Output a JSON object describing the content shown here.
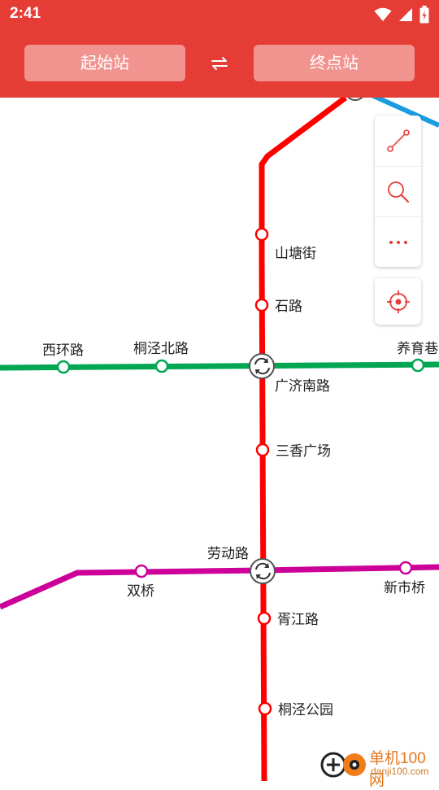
{
  "status_bar": {
    "time": "2:41"
  },
  "header": {
    "start_station_placeholder": "起始站",
    "end_station_placeholder": "终点站",
    "swap_glyph": "⇆"
  },
  "map": {
    "lines": {
      "line_red": {
        "color": "#ff0000"
      },
      "line_green": {
        "color": "#00a651"
      },
      "line_magenta": {
        "color": "#cc0099"
      },
      "line_blue": {
        "color": "#1a9de0"
      }
    },
    "stations": {
      "shantang_jie": "山塘街",
      "shi_lu": "石路",
      "xihuan_lu": "西环路",
      "tongjing_bei_lu": "桐泾北路",
      "yangyu_xiang": "养育巷",
      "guangji_nan_lu": "广济南路",
      "sanxiang_guangchang": "三香广场",
      "laodong_lu": "劳动路",
      "shuang_qiao": "双桥",
      "xinshi_qiao": "新市桥",
      "xujiang_lu": "胥江路",
      "tongjing_gongyuan": "桐泾公园"
    }
  },
  "toolbar": {
    "route_icon": "route-icon",
    "search_icon": "search-icon",
    "more_icon": "more-icon",
    "locate_icon": "locate-icon"
  },
  "watermark": {
    "title": "单机100网",
    "url": "danji100.com"
  }
}
